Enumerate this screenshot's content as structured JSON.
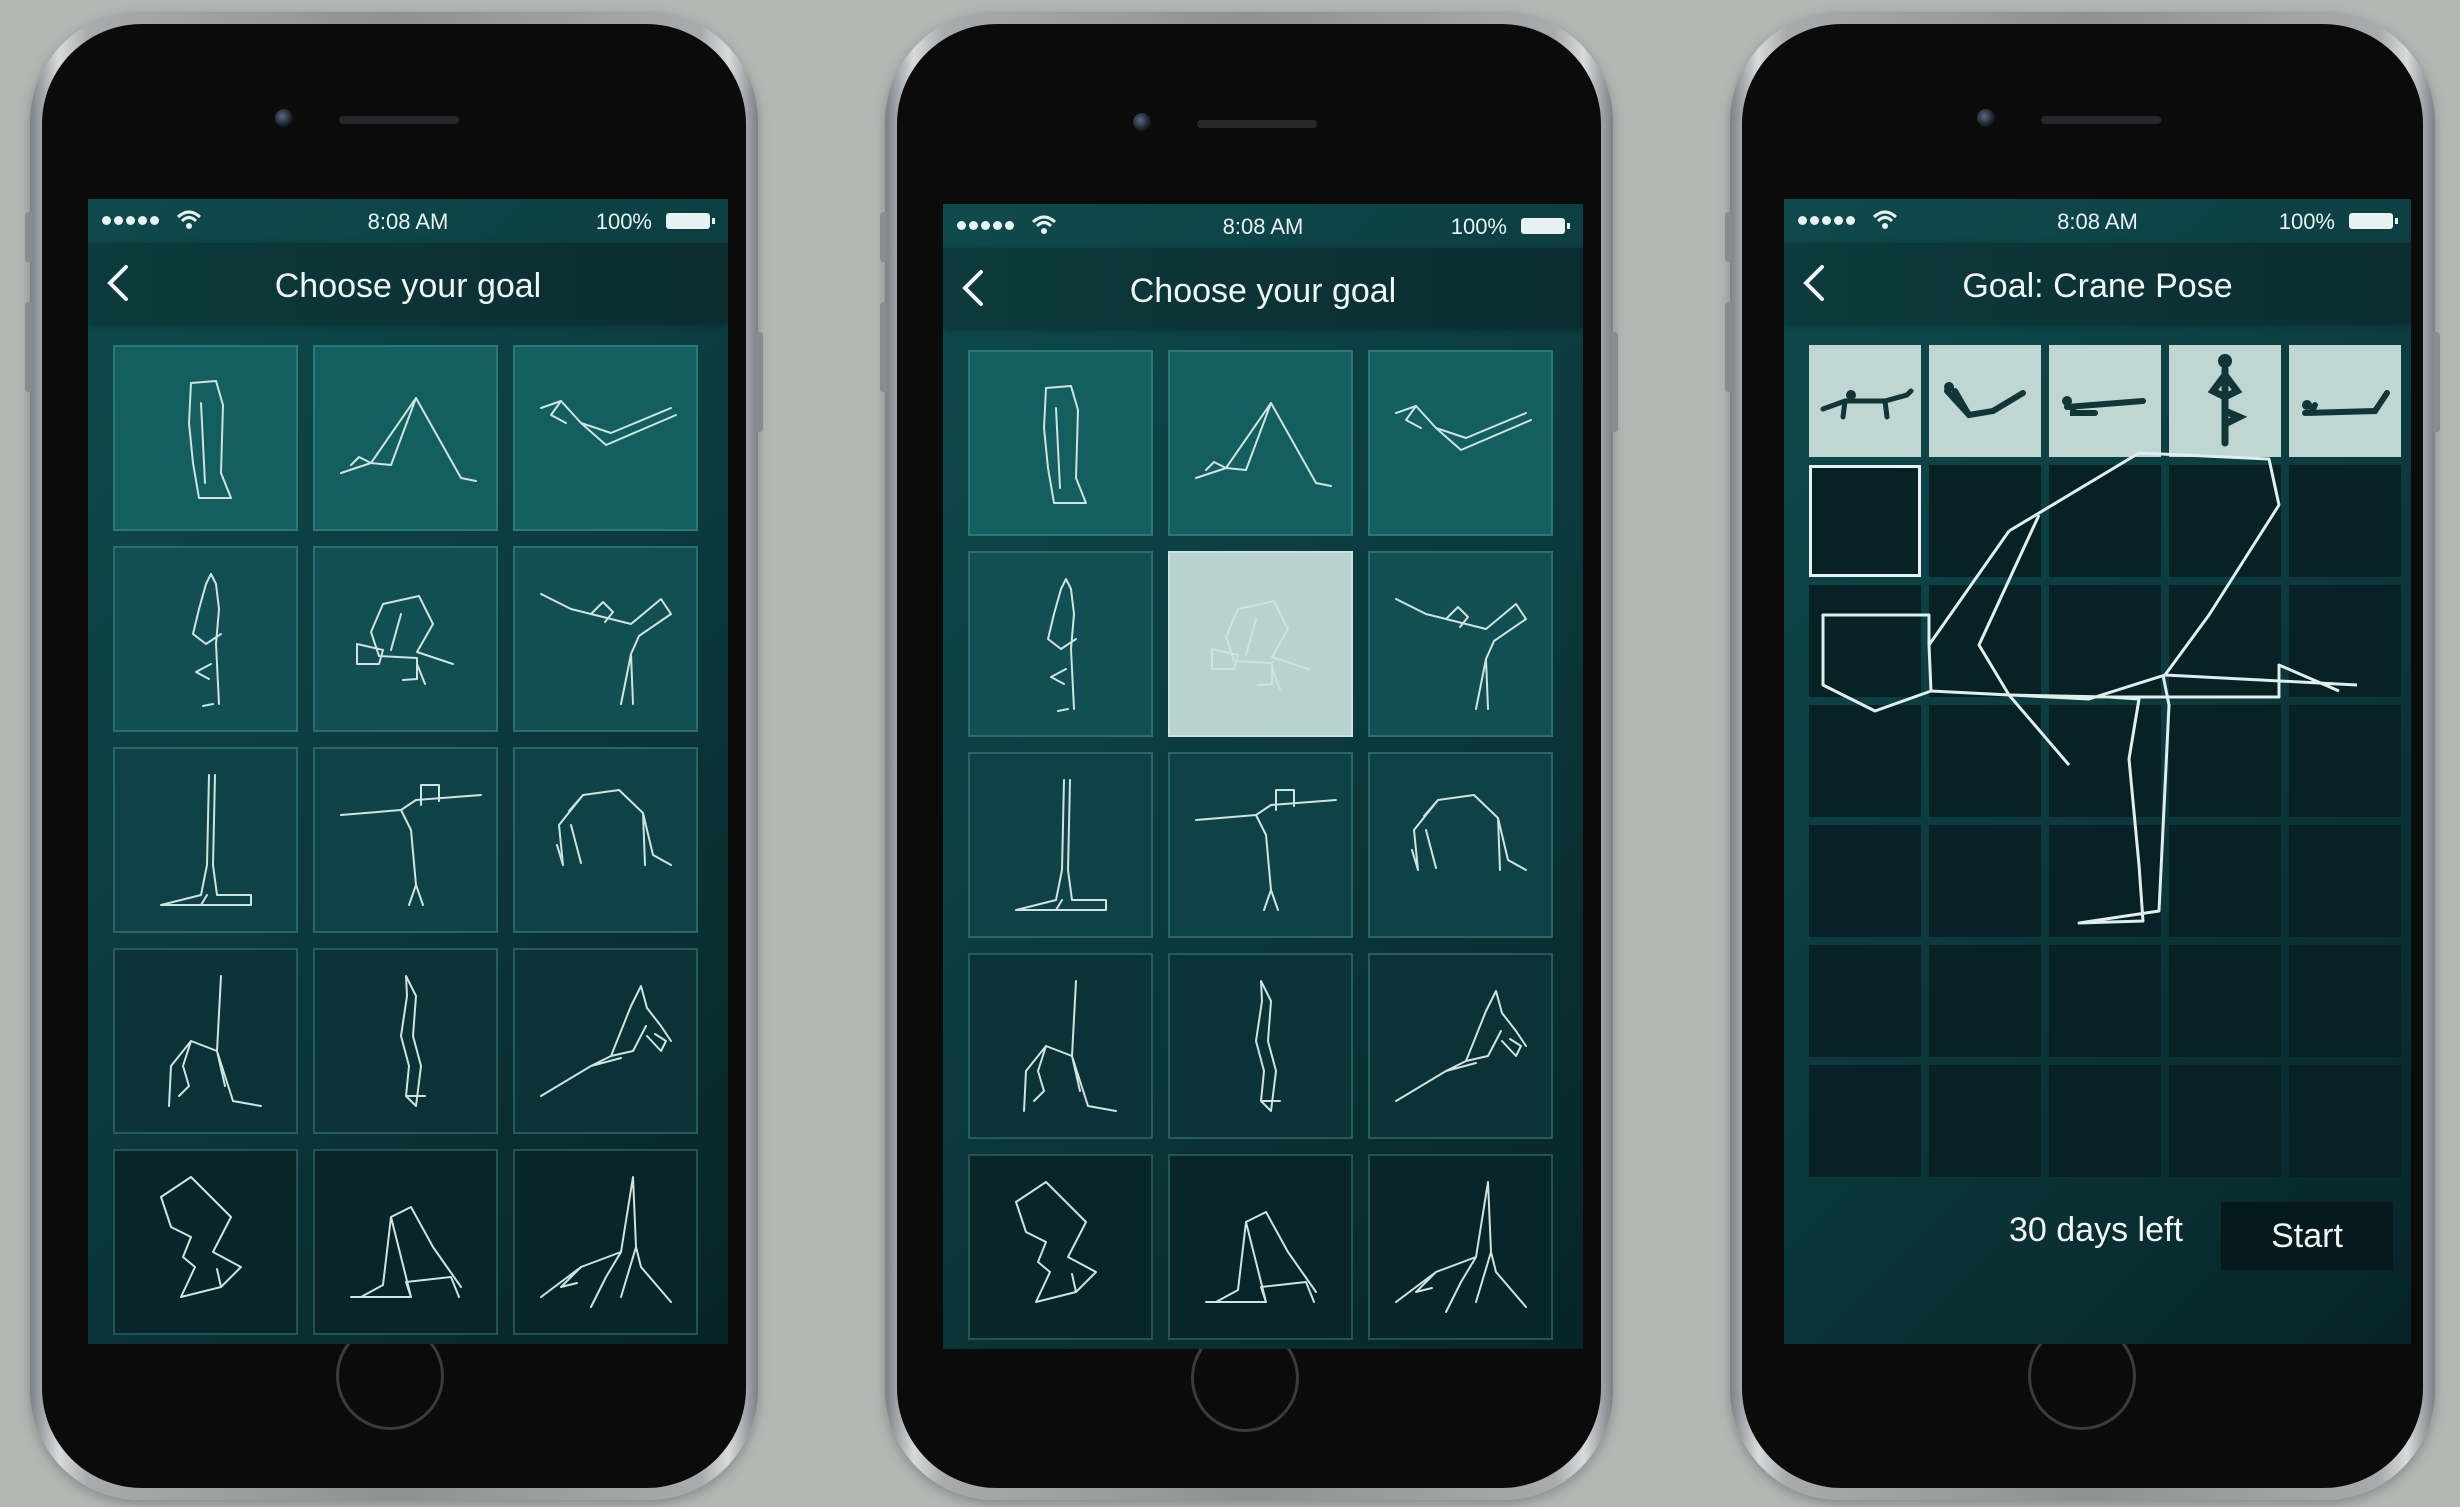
{
  "status_bar": {
    "time": "8:08 AM",
    "battery": "100%"
  },
  "screens": [
    {
      "title": "Choose your goal"
    },
    {
      "title": "Choose your goal"
    },
    {
      "title": "Goal: Crane Pose",
      "days_left": "30 days left",
      "start_label": "Start"
    }
  ],
  "poses": [
    "forward-fold-icon",
    "downward-dog-icon",
    "boat-pose-icon",
    "tree-pose-icon",
    "crane-pose-icon",
    "dancer-pose-icon",
    "shoulder-stand-icon",
    "warrior-three-icon",
    "wheel-pose-icon",
    "one-leg-wheel-icon",
    "headstand-icon",
    "side-plank-icon",
    "scorpion-pose-icon",
    "plow-pose-icon",
    "triangle-pose-icon"
  ],
  "selected_pose": "crane-pose-icon",
  "colors": {
    "accent": "#0e4a4c",
    "selected": "#b9d3d0",
    "outline": "#cfe3df"
  }
}
